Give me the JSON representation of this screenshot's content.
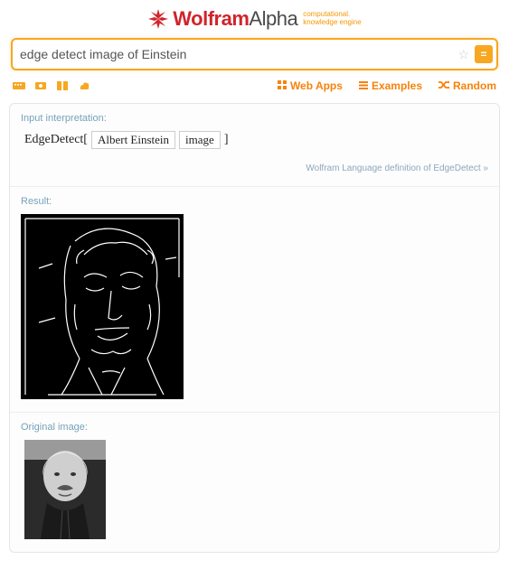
{
  "header": {
    "brand_first": "Wolfram",
    "brand_second": "Alpha",
    "tagline_l1": "computational.",
    "tagline_l2": "knowledge engine"
  },
  "search": {
    "value": "edge detect image of Einstein",
    "placeholder": ""
  },
  "nav": {
    "webapps": "Web Apps",
    "examples": "Examples",
    "random": "Random"
  },
  "pods": {
    "interpretation": {
      "title": "Input interpretation:",
      "fn": "EdgeDetect",
      "arg1": "Albert Einstein",
      "arg2": "image",
      "footer_link": "Wolfram Language definition of EdgeDetect »"
    },
    "result": {
      "title": "Result:"
    },
    "original": {
      "title": "Original image:"
    }
  }
}
